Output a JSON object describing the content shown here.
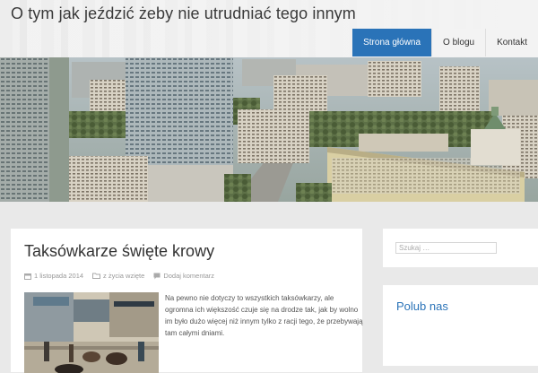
{
  "site": {
    "title": "O tym jak jeździć żeby nie utrudniać tego innym"
  },
  "nav": {
    "items": [
      {
        "label": "Strona główna",
        "active": true
      },
      {
        "label": "O blogu",
        "active": false
      },
      {
        "label": "Kontakt",
        "active": false
      }
    ]
  },
  "post": {
    "title": "Taksówkarze święte krowy",
    "date": "1 listopada 2014",
    "category": "z życia wzięte",
    "comments": "Dodaj komentarz",
    "excerpt": "Na pewno nie dotyczy to wszystkich taksówkarzy, ale ogromna ich większość czuje się na drodze tak, jak by wolno im było dużo więcej niż innym tylko z racji tego, że przebywają tam całymi dniami."
  },
  "sidebar": {
    "search": {
      "placeholder": "Szukaj …"
    },
    "like_widget": {
      "title": "Polub nas"
    }
  },
  "colors": {
    "accent": "#2a73b8",
    "background": "#e9e9e9",
    "card": "#ffffff"
  },
  "icons": {
    "date": "calendar-icon",
    "category": "folder-icon",
    "comments": "comment-icon"
  }
}
